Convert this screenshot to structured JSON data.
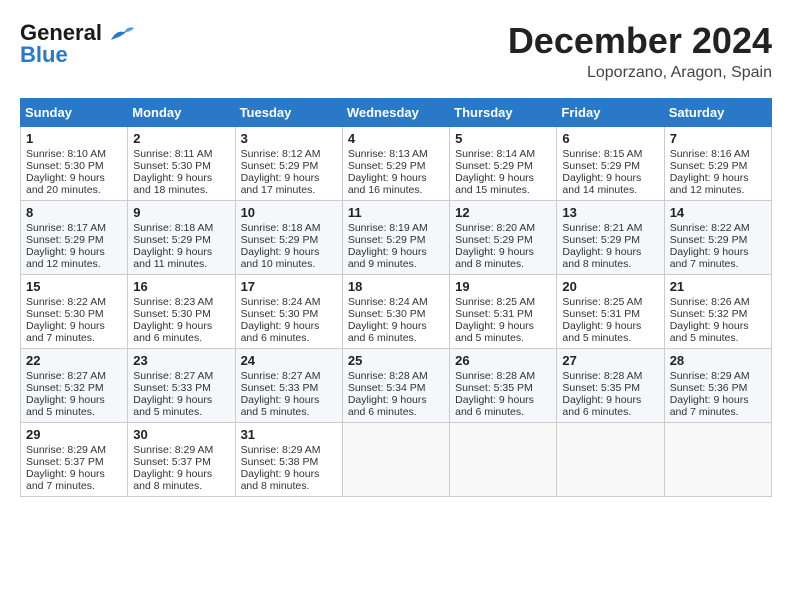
{
  "header": {
    "logo_general": "General",
    "logo_blue": "Blue",
    "month": "December 2024",
    "location": "Loporzano, Aragon, Spain"
  },
  "days_of_week": [
    "Sunday",
    "Monday",
    "Tuesday",
    "Wednesday",
    "Thursday",
    "Friday",
    "Saturday"
  ],
  "weeks": [
    [
      {
        "day": 1,
        "lines": [
          "Sunrise: 8:10 AM",
          "Sunset: 5:30 PM",
          "Daylight: 9 hours",
          "and 20 minutes."
        ]
      },
      {
        "day": 2,
        "lines": [
          "Sunrise: 8:11 AM",
          "Sunset: 5:30 PM",
          "Daylight: 9 hours",
          "and 18 minutes."
        ]
      },
      {
        "day": 3,
        "lines": [
          "Sunrise: 8:12 AM",
          "Sunset: 5:29 PM",
          "Daylight: 9 hours",
          "and 17 minutes."
        ]
      },
      {
        "day": 4,
        "lines": [
          "Sunrise: 8:13 AM",
          "Sunset: 5:29 PM",
          "Daylight: 9 hours",
          "and 16 minutes."
        ]
      },
      {
        "day": 5,
        "lines": [
          "Sunrise: 8:14 AM",
          "Sunset: 5:29 PM",
          "Daylight: 9 hours",
          "and 15 minutes."
        ]
      },
      {
        "day": 6,
        "lines": [
          "Sunrise: 8:15 AM",
          "Sunset: 5:29 PM",
          "Daylight: 9 hours",
          "and 14 minutes."
        ]
      },
      {
        "day": 7,
        "lines": [
          "Sunrise: 8:16 AM",
          "Sunset: 5:29 PM",
          "Daylight: 9 hours",
          "and 12 minutes."
        ]
      }
    ],
    [
      {
        "day": 8,
        "lines": [
          "Sunrise: 8:17 AM",
          "Sunset: 5:29 PM",
          "Daylight: 9 hours",
          "and 12 minutes."
        ]
      },
      {
        "day": 9,
        "lines": [
          "Sunrise: 8:18 AM",
          "Sunset: 5:29 PM",
          "Daylight: 9 hours",
          "and 11 minutes."
        ]
      },
      {
        "day": 10,
        "lines": [
          "Sunrise: 8:18 AM",
          "Sunset: 5:29 PM",
          "Daylight: 9 hours",
          "and 10 minutes."
        ]
      },
      {
        "day": 11,
        "lines": [
          "Sunrise: 8:19 AM",
          "Sunset: 5:29 PM",
          "Daylight: 9 hours",
          "and 9 minutes."
        ]
      },
      {
        "day": 12,
        "lines": [
          "Sunrise: 8:20 AM",
          "Sunset: 5:29 PM",
          "Daylight: 9 hours",
          "and 8 minutes."
        ]
      },
      {
        "day": 13,
        "lines": [
          "Sunrise: 8:21 AM",
          "Sunset: 5:29 PM",
          "Daylight: 9 hours",
          "and 8 minutes."
        ]
      },
      {
        "day": 14,
        "lines": [
          "Sunrise: 8:22 AM",
          "Sunset: 5:29 PM",
          "Daylight: 9 hours",
          "and 7 minutes."
        ]
      }
    ],
    [
      {
        "day": 15,
        "lines": [
          "Sunrise: 8:22 AM",
          "Sunset: 5:30 PM",
          "Daylight: 9 hours",
          "and 7 minutes."
        ]
      },
      {
        "day": 16,
        "lines": [
          "Sunrise: 8:23 AM",
          "Sunset: 5:30 PM",
          "Daylight: 9 hours",
          "and 6 minutes."
        ]
      },
      {
        "day": 17,
        "lines": [
          "Sunrise: 8:24 AM",
          "Sunset: 5:30 PM",
          "Daylight: 9 hours",
          "and 6 minutes."
        ]
      },
      {
        "day": 18,
        "lines": [
          "Sunrise: 8:24 AM",
          "Sunset: 5:30 PM",
          "Daylight: 9 hours",
          "and 6 minutes."
        ]
      },
      {
        "day": 19,
        "lines": [
          "Sunrise: 8:25 AM",
          "Sunset: 5:31 PM",
          "Daylight: 9 hours",
          "and 5 minutes."
        ]
      },
      {
        "day": 20,
        "lines": [
          "Sunrise: 8:25 AM",
          "Sunset: 5:31 PM",
          "Daylight: 9 hours",
          "and 5 minutes."
        ]
      },
      {
        "day": 21,
        "lines": [
          "Sunrise: 8:26 AM",
          "Sunset: 5:32 PM",
          "Daylight: 9 hours",
          "and 5 minutes."
        ]
      }
    ],
    [
      {
        "day": 22,
        "lines": [
          "Sunrise: 8:27 AM",
          "Sunset: 5:32 PM",
          "Daylight: 9 hours",
          "and 5 minutes."
        ]
      },
      {
        "day": 23,
        "lines": [
          "Sunrise: 8:27 AM",
          "Sunset: 5:33 PM",
          "Daylight: 9 hours",
          "and 5 minutes."
        ]
      },
      {
        "day": 24,
        "lines": [
          "Sunrise: 8:27 AM",
          "Sunset: 5:33 PM",
          "Daylight: 9 hours",
          "and 5 minutes."
        ]
      },
      {
        "day": 25,
        "lines": [
          "Sunrise: 8:28 AM",
          "Sunset: 5:34 PM",
          "Daylight: 9 hours",
          "and 6 minutes."
        ]
      },
      {
        "day": 26,
        "lines": [
          "Sunrise: 8:28 AM",
          "Sunset: 5:35 PM",
          "Daylight: 9 hours",
          "and 6 minutes."
        ]
      },
      {
        "day": 27,
        "lines": [
          "Sunrise: 8:28 AM",
          "Sunset: 5:35 PM",
          "Daylight: 9 hours",
          "and 6 minutes."
        ]
      },
      {
        "day": 28,
        "lines": [
          "Sunrise: 8:29 AM",
          "Sunset: 5:36 PM",
          "Daylight: 9 hours",
          "and 7 minutes."
        ]
      }
    ],
    [
      {
        "day": 29,
        "lines": [
          "Sunrise: 8:29 AM",
          "Sunset: 5:37 PM",
          "Daylight: 9 hours",
          "and 7 minutes."
        ]
      },
      {
        "day": 30,
        "lines": [
          "Sunrise: 8:29 AM",
          "Sunset: 5:37 PM",
          "Daylight: 9 hours",
          "and 8 minutes."
        ]
      },
      {
        "day": 31,
        "lines": [
          "Sunrise: 8:29 AM",
          "Sunset: 5:38 PM",
          "Daylight: 9 hours",
          "and 8 minutes."
        ]
      },
      null,
      null,
      null,
      null
    ]
  ]
}
